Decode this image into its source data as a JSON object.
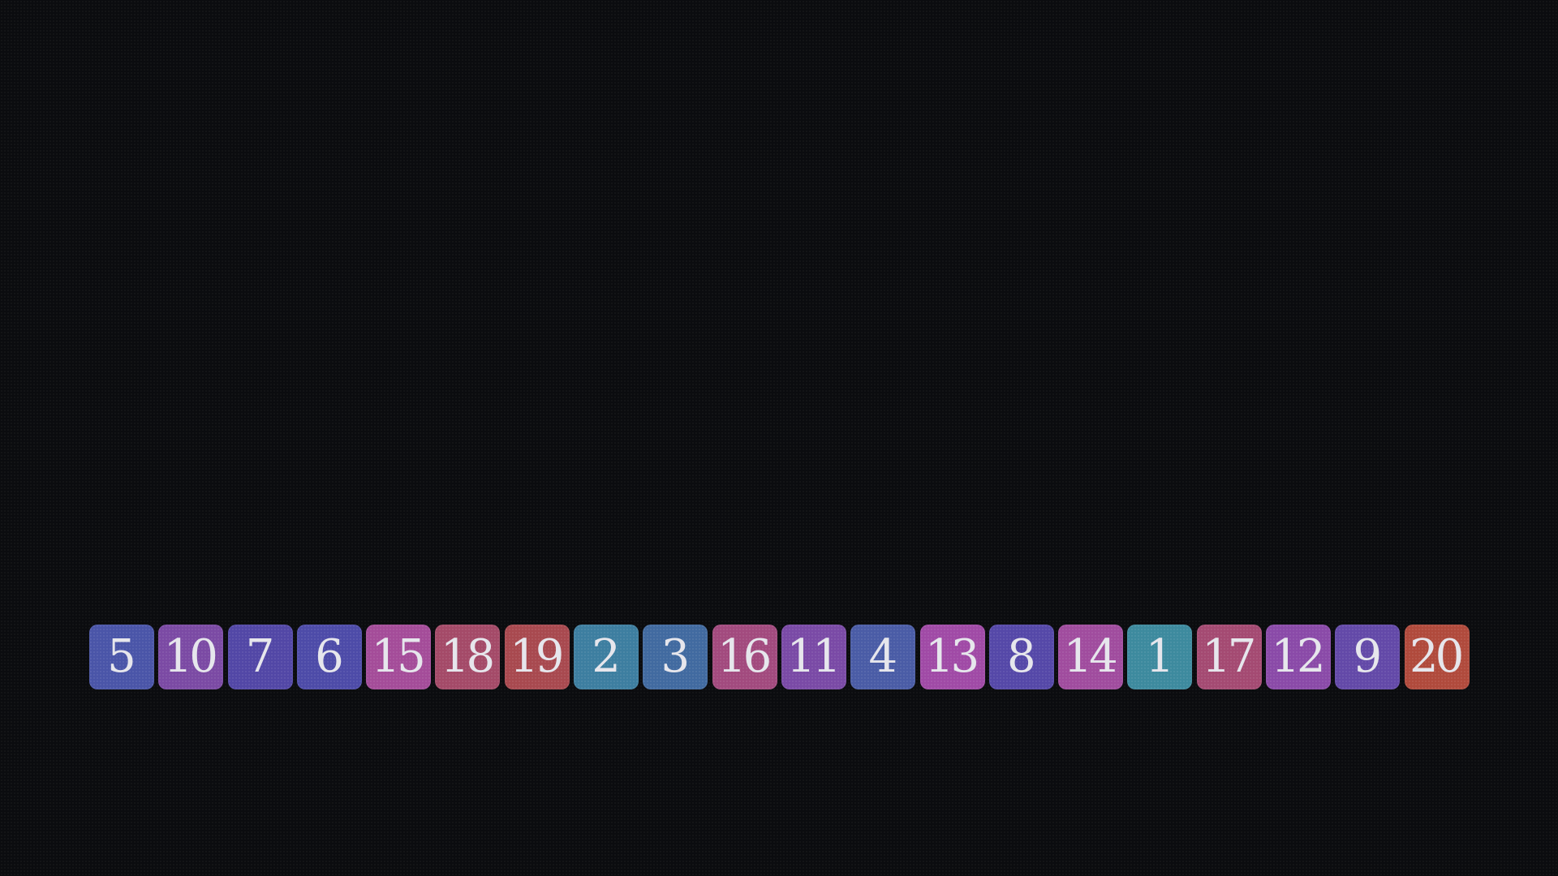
{
  "tiles": [
    {
      "label": "5",
      "color": "#4a55a8"
    },
    {
      "label": "10",
      "color": "#7b4aa4"
    },
    {
      "label": "7",
      "color": "#5247a6"
    },
    {
      "label": "6",
      "color": "#4d4ba8"
    },
    {
      "label": "15",
      "color": "#a44c99"
    },
    {
      "label": "18",
      "color": "#a44a68"
    },
    {
      "label": "19",
      "color": "#a8494f"
    },
    {
      "label": "2",
      "color": "#3d7ea0"
    },
    {
      "label": "3",
      "color": "#416aa0"
    },
    {
      "label": "16",
      "color": "#a24a7e"
    },
    {
      "label": "11",
      "color": "#7a4aa6"
    },
    {
      "label": "4",
      "color": "#4a5ca6"
    },
    {
      "label": "13",
      "color": "#a04aa6"
    },
    {
      "label": "8",
      "color": "#5548a8"
    },
    {
      "label": "14",
      "color": "#a04c9e"
    },
    {
      "label": "1",
      "color": "#3d8a9e"
    },
    {
      "label": "17",
      "color": "#a44a72"
    },
    {
      "label": "12",
      "color": "#8a4aa8"
    },
    {
      "label": "9",
      "color": "#6349a8"
    },
    {
      "label": "20",
      "color": "#b04a3c"
    }
  ]
}
